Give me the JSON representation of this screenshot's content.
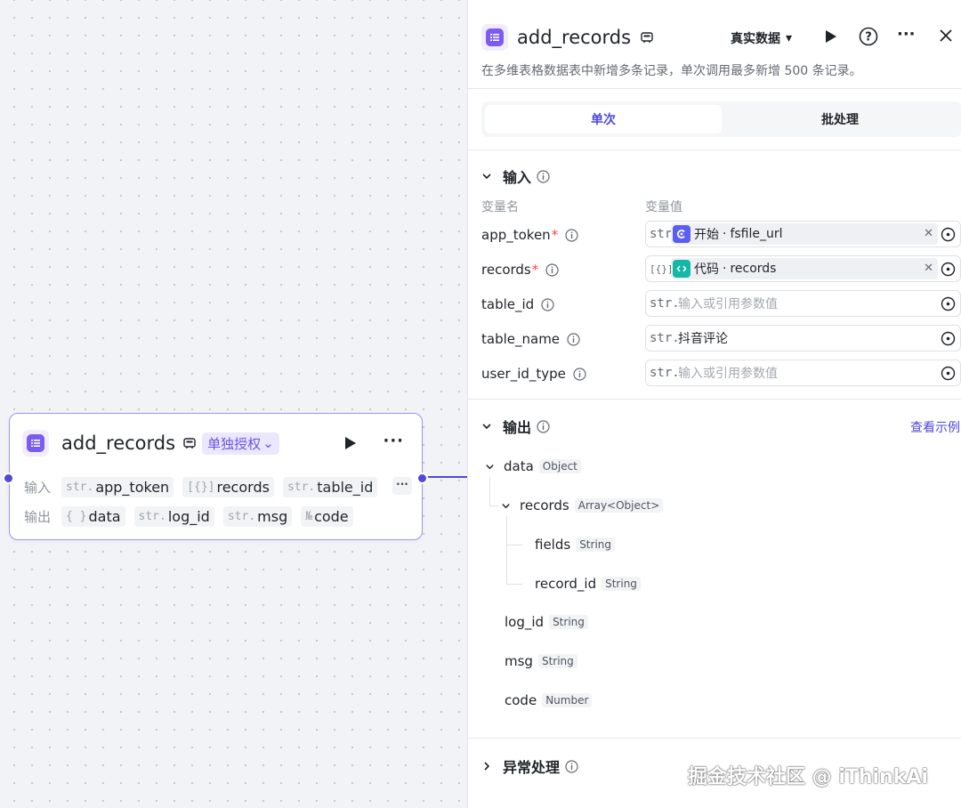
{
  "node": {
    "title": "add_records",
    "auth_label": "单独授权",
    "input_label": "输入",
    "output_label": "输出",
    "inputs": [
      {
        "type": "str.",
        "name": "app_token"
      },
      {
        "type": "[{}]",
        "name": "records"
      },
      {
        "type": "str.",
        "name": "table_id"
      }
    ],
    "outputs": [
      {
        "type": "{ }",
        "name": "data"
      },
      {
        "type": "str.",
        "name": "log_id"
      },
      {
        "type": "str.",
        "name": "msg"
      },
      {
        "type": "№",
        "name": "code"
      }
    ],
    "more_inputs": "···"
  },
  "panel": {
    "title": "add_records",
    "data_mode": "真实数据",
    "description": "在多维表格数据表中新增多条记录，单次调用最多新增 500 条记录。",
    "tabs": [
      {
        "label": "单次",
        "active": true
      },
      {
        "label": "批处理",
        "active": false
      }
    ],
    "input_section": "输入",
    "col_name": "变量名",
    "col_value": "变量值",
    "params": [
      {
        "name": "app_token",
        "required": true,
        "type": "str.",
        "ref_source": "开始",
        "ref_field": "fsfile_url",
        "ref_color": "#5b5ff0"
      },
      {
        "name": "records",
        "required": true,
        "type": "[{}]",
        "ref_source": "代码",
        "ref_field": "records",
        "ref_color": "#14b8a6"
      },
      {
        "name": "table_id",
        "required": false,
        "type": "str.",
        "placeholder": "输入或引用参数值"
      },
      {
        "name": "table_name",
        "required": false,
        "type": "str.",
        "value": "抖音评论"
      },
      {
        "name": "user_id_type",
        "required": false,
        "type": "str.",
        "placeholder": "输入或引用参数值"
      }
    ],
    "output_section": "输出",
    "see_example": "查看示例",
    "outputs": [
      {
        "name": "data",
        "type": "Object"
      },
      {
        "name": "records",
        "type": "Array<Object>"
      },
      {
        "name": "fields",
        "type": "String"
      },
      {
        "name": "record_id",
        "type": "String"
      },
      {
        "name": "log_id",
        "type": "String"
      },
      {
        "name": "msg",
        "type": "String"
      },
      {
        "name": "code",
        "type": "Number"
      }
    ],
    "error_section": "异常处理"
  },
  "watermark": "掘金技术社区 @ iThinkAi",
  "colors": {
    "accent": "#4e49d8",
    "node_border": "#9d95f0",
    "required": "#f54a45"
  }
}
